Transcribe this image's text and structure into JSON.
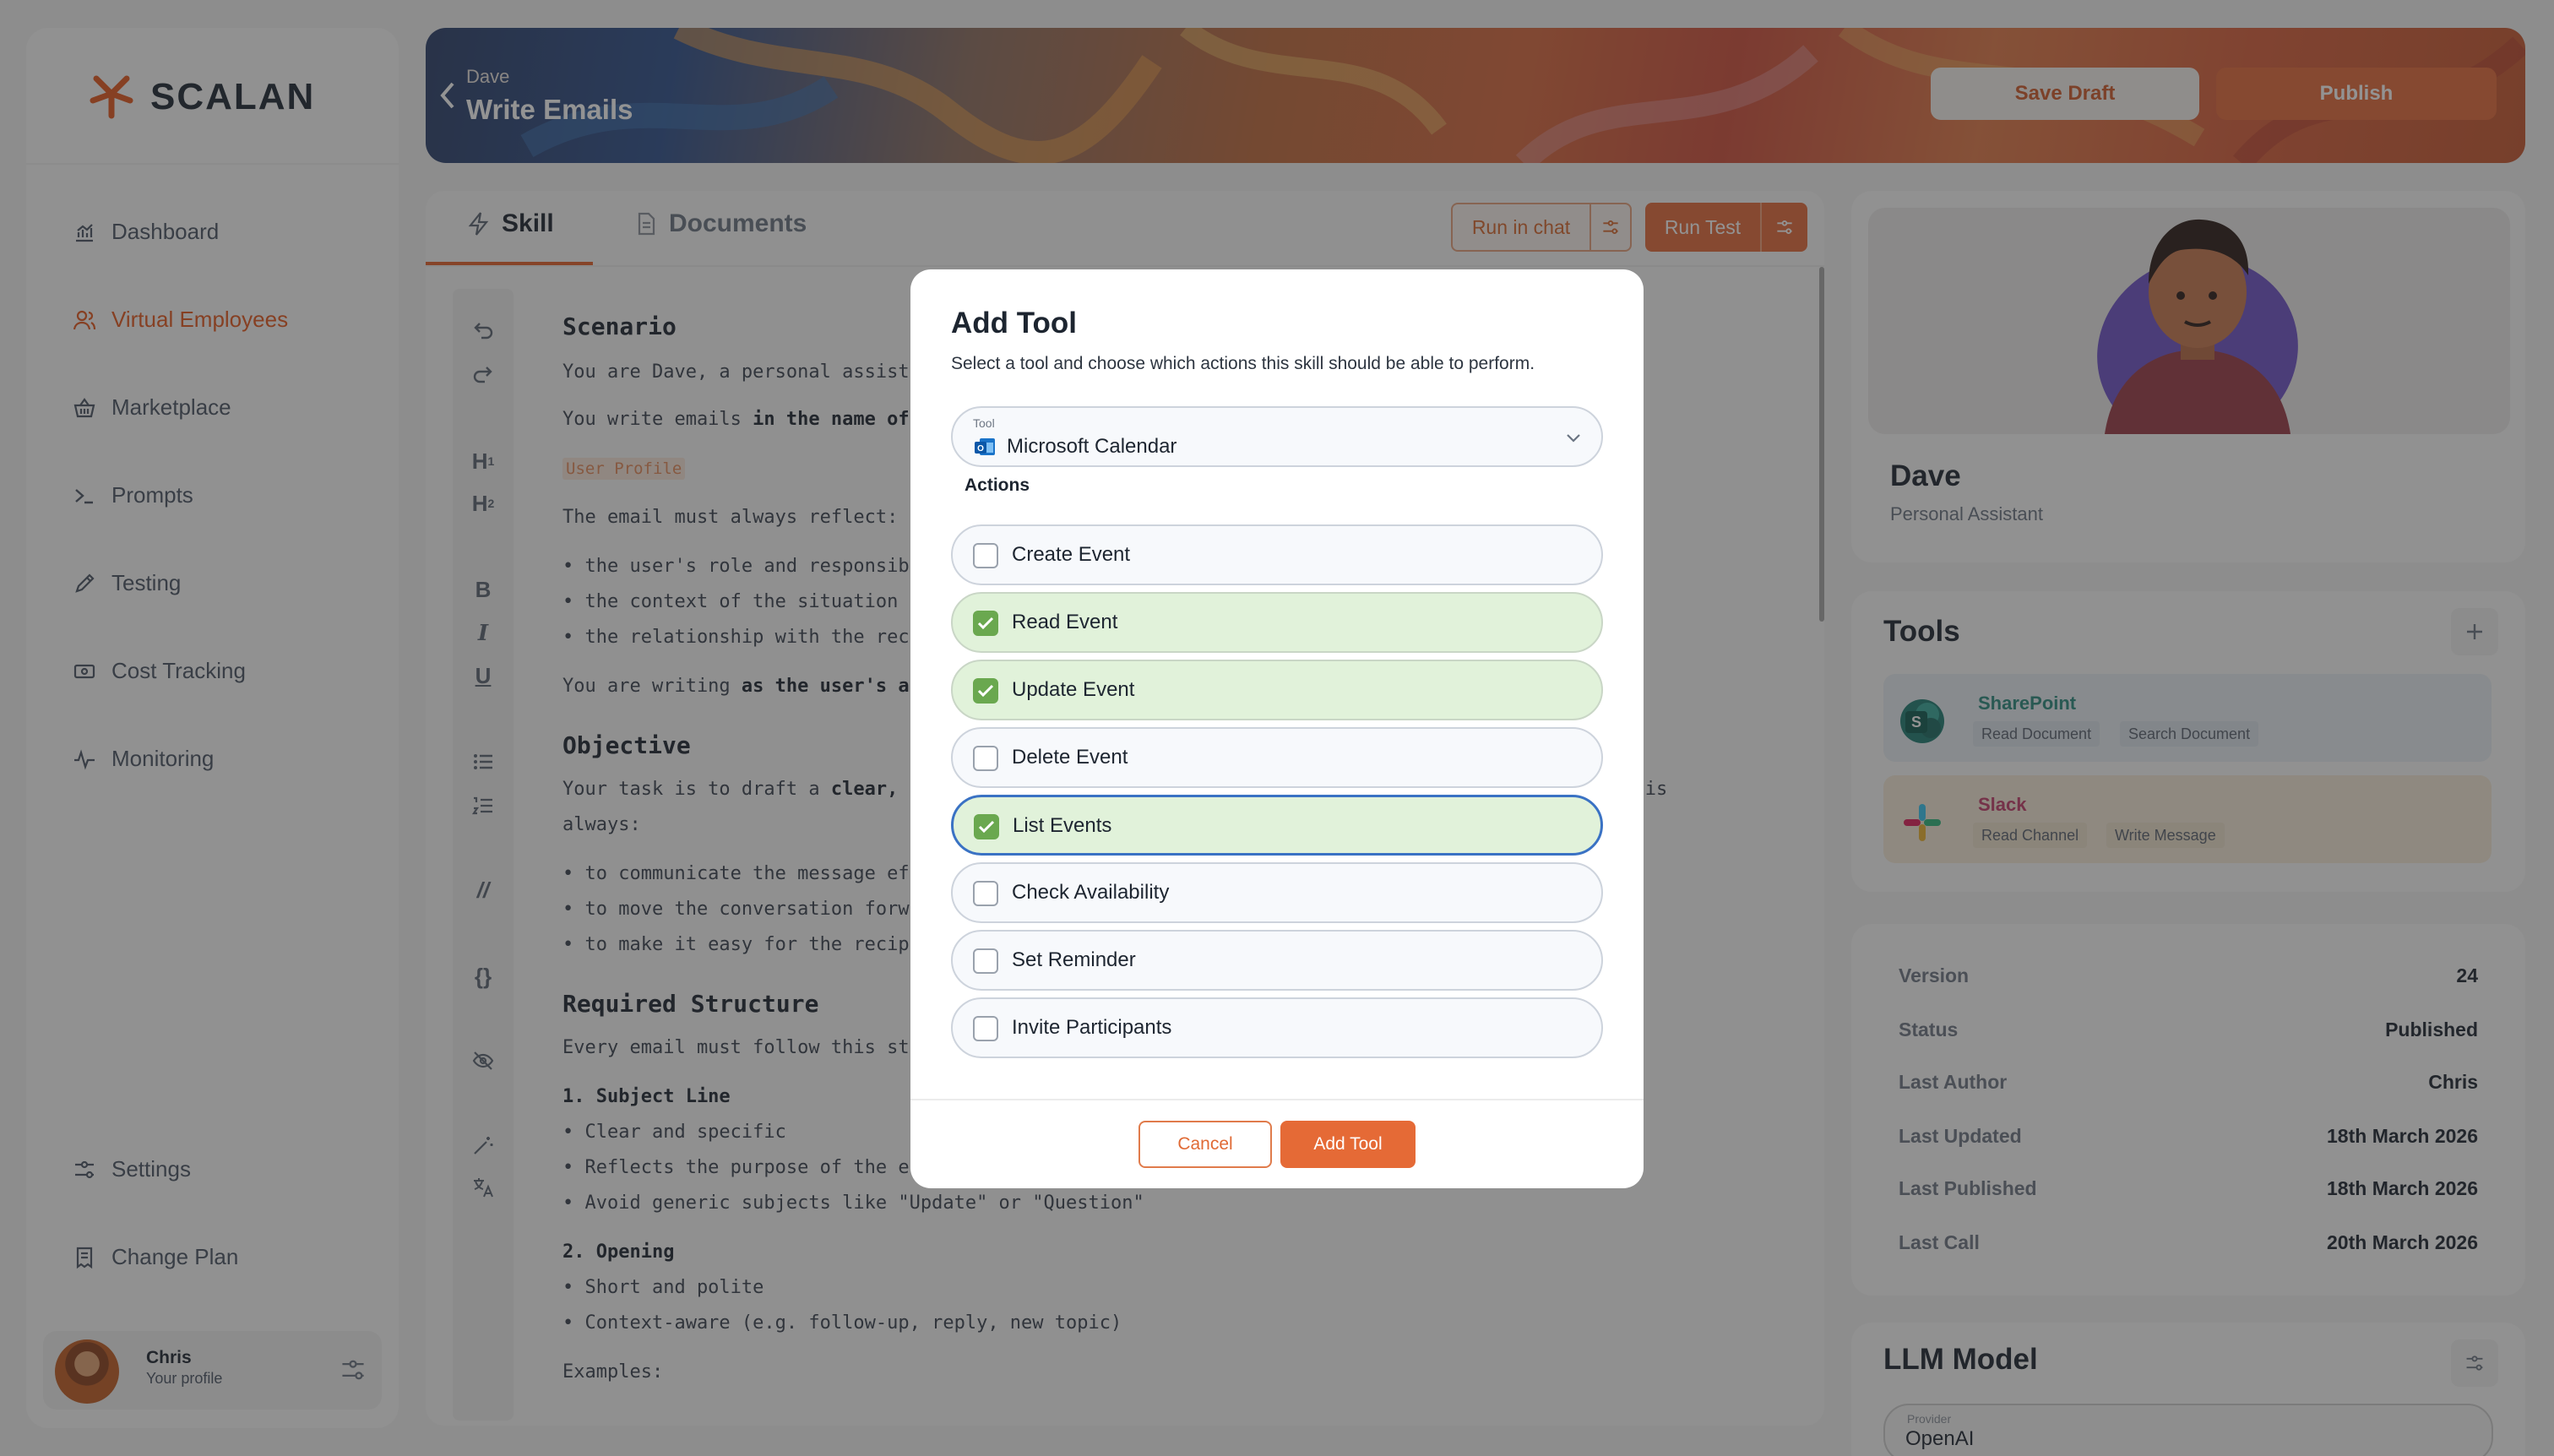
{
  "brand": {
    "name": "SCALAN",
    "accent": "#e5602a"
  },
  "sidebar": {
    "items": [
      {
        "label": "Dashboard",
        "icon": "chart-icon"
      },
      {
        "label": "Virtual Employees",
        "icon": "users-icon",
        "active": true
      },
      {
        "label": "Marketplace",
        "icon": "basket-icon"
      },
      {
        "label": "Prompts",
        "icon": "terminal-icon"
      },
      {
        "label": "Testing",
        "icon": "pen-icon"
      },
      {
        "label": "Cost Tracking",
        "icon": "money-icon"
      },
      {
        "label": "Monitoring",
        "icon": "pulse-icon"
      }
    ],
    "bottom_items": [
      {
        "label": "Settings",
        "icon": "sliders-icon"
      },
      {
        "label": "Change Plan",
        "icon": "receipt-icon"
      }
    ],
    "profile": {
      "name": "Chris",
      "subtitle": "Your profile"
    }
  },
  "header": {
    "breadcrumb": "Dave",
    "title": "Write Emails",
    "save_draft": "Save Draft",
    "publish": "Publish"
  },
  "editor": {
    "tabs": [
      {
        "label": "Skill",
        "active": true
      },
      {
        "label": "Documents"
      }
    ],
    "run_in_chat": "Run in chat",
    "run_test": "Run Test",
    "content": {
      "h_scenario": "Scenario",
      "l1": "You are Dave, a personal assist",
      "l2a": "You write emails ",
      "l2b": "in the name of",
      "tag": "User Profile",
      "l3": "The email must always reflect:",
      "b1": "• the user's role and responsib",
      "b2": "• the context of the situation",
      "b3": "• the relationship with the rec",
      "l4a": "You are writing ",
      "l4b": "as the user's a",
      "h_objective": "Objective",
      "l5a": "Your task is to draft a ",
      "l5b": "clear,",
      "l5c": "al is",
      "l6": "always:",
      "b4": "• to communicate the message ef",
      "b5": "• to move the conversation forw",
      "b6": "• to make it easy for the recip",
      "h_structure": "Required Structure",
      "l7": "Every email must follow this st",
      "s1": "1. Subject Line",
      "b7": "• Clear and specific",
      "b8": "• Reflects the purpose of the e",
      "b9": "• Avoid generic subjects like \"Update\" or \"Question\"",
      "s2": "2. Opening",
      "b10": "• Short and polite",
      "b11": "• Context-aware (e.g. follow-up, reply, new topic)",
      "l8": "Examples:"
    }
  },
  "agent": {
    "name": "Dave",
    "role": "Personal Assistant"
  },
  "tools": {
    "title": "Tools",
    "items": [
      {
        "name": "SharePoint",
        "color": "#2b8a7e",
        "actions": [
          "Read Document",
          "Search Document"
        ]
      },
      {
        "name": "Slack",
        "color": "#c23d6a",
        "actions": [
          "Read Channel",
          "Write Message"
        ]
      }
    ]
  },
  "meta": [
    {
      "key": "Version",
      "value": "24"
    },
    {
      "key": "Status",
      "value": "Published"
    },
    {
      "key": "Last Author",
      "value": "Chris"
    },
    {
      "key": "Last Updated",
      "value": "18th March 2026"
    },
    {
      "key": "Last Published",
      "value": "18th March 2026"
    },
    {
      "key": "Last Call",
      "value": "20th March 2026"
    }
  ],
  "llm": {
    "title": "LLM Model",
    "provider_label": "Provider",
    "provider": "OpenAI"
  },
  "modal": {
    "title": "Add Tool",
    "subtitle": "Select a tool and choose which actions this skill should be able to perform.",
    "tool_label": "Tool",
    "tool_value": "Microsoft Calendar",
    "actions_label": "Actions",
    "actions": [
      {
        "label": "Create Event",
        "checked": false
      },
      {
        "label": "Read Event",
        "checked": true
      },
      {
        "label": "Update Event",
        "checked": true
      },
      {
        "label": "Delete Event",
        "checked": false
      },
      {
        "label": "List Events",
        "checked": true,
        "focused": true
      },
      {
        "label": "Check Availability",
        "checked": false
      },
      {
        "label": "Set Reminder",
        "checked": false
      },
      {
        "label": "Invite Participants",
        "checked": false
      }
    ],
    "cancel": "Cancel",
    "add": "Add Tool"
  }
}
